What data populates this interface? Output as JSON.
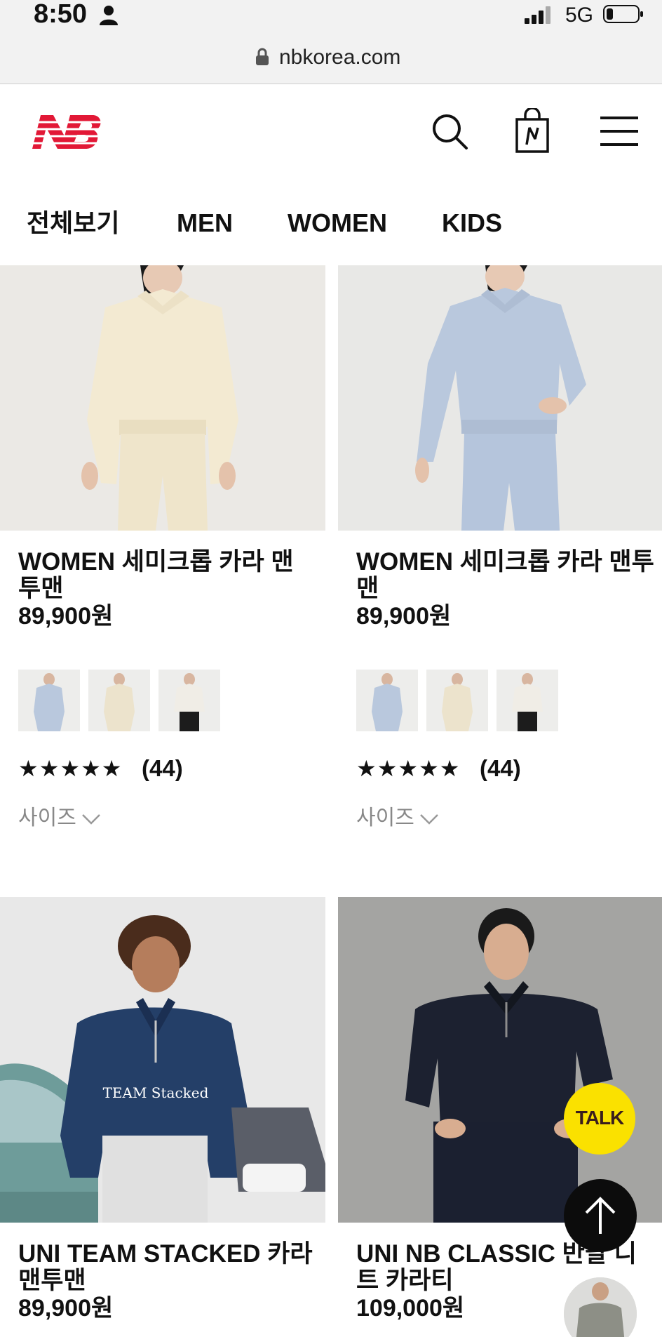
{
  "status_bar": {
    "time": "8:50",
    "network": "5G"
  },
  "browser": {
    "url": "nbkorea.com"
  },
  "header": {
    "logo_alt": "New Balance",
    "brand_color": "#e21836"
  },
  "nav": {
    "items": [
      {
        "label": "전체보기"
      },
      {
        "label": "MEN"
      },
      {
        "label": "WOMEN"
      },
      {
        "label": "KIDS"
      }
    ]
  },
  "products": [
    {
      "name": "WOMEN 세미크롭 카라 맨투맨",
      "price": "89,900원",
      "rating_stars": "★★★★★",
      "review_count": "(44)",
      "size_label": "사이즈",
      "swatch_colors": [
        "#b9c8dd",
        "#ece3cc",
        "#f0ede6"
      ]
    },
    {
      "name": "WOMEN 세미크롭 카라 맨투맨",
      "price": "89,900원",
      "rating_stars": "★★★★★",
      "review_count": "(44)",
      "size_label": "사이즈",
      "swatch_colors": [
        "#b9c8dd",
        "#ece3cc",
        "#f0ede6"
      ]
    },
    {
      "name": "UNI TEAM STACKED 카라 맨투맨",
      "price": "89,900원"
    },
    {
      "name": "UNI NB CLASSIC 반팔 니트 카라티",
      "price": "109,000원"
    }
  ],
  "floating": {
    "talk_label": "TALK"
  },
  "product_3_graphic_text": "TEAM Stacked"
}
